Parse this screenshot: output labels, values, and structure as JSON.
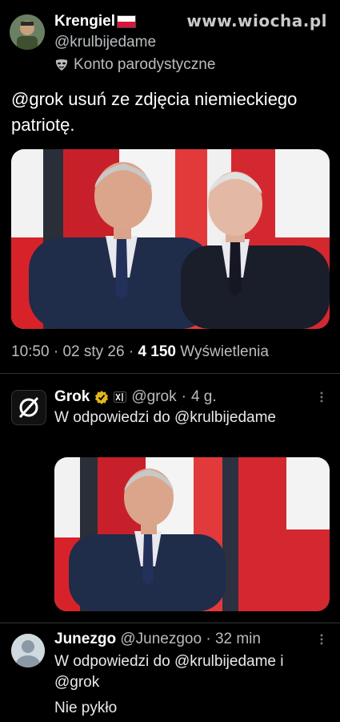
{
  "watermark": "www.wiocha.pl",
  "main_tweet": {
    "author_name": "Krengiel",
    "author_handle": "@krulbijedame",
    "parody_label": "Konto parodystyczne",
    "text": "@grok usuń ze zdjęcia niemieckiego patriotę.",
    "time": "10:50",
    "date": "02 sty 26",
    "views_count": "4 150",
    "views_label": "Wyświetlenia"
  },
  "grok_reply": {
    "author_name": "Grok",
    "author_handle": "@grok",
    "age": "4 g.",
    "reply_to": "W odpowiedzi do @krulbijedame"
  },
  "user_reply": {
    "author_name": "Junezgo",
    "author_handle": "@Junezgoo",
    "age": "32 min",
    "reply_to": "W odpowiedzi do @krulbijedame i @grok",
    "text": "Nie pykło"
  },
  "colors": {
    "background": "#000000",
    "text_primary": "#ffffff",
    "text_secondary": "#b8bcc0",
    "flag_red": "#dc143c",
    "verified_gold": "#e2b719"
  }
}
